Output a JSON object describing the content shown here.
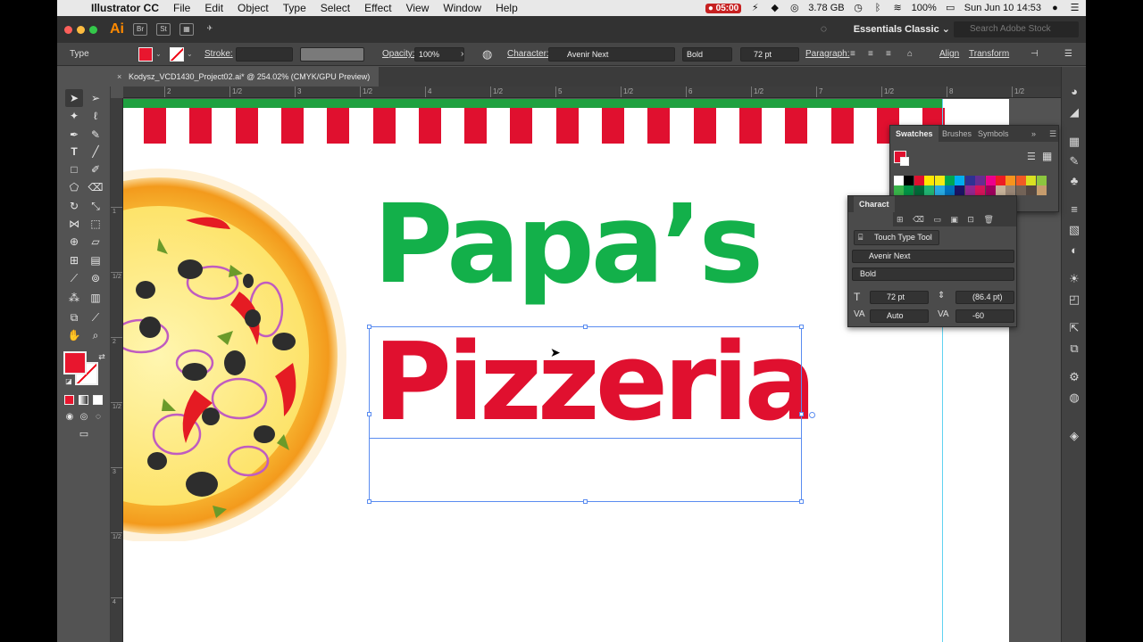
{
  "menubar": {
    "app_name": "Illustrator CC",
    "items": [
      "File",
      "Edit",
      "Object",
      "Type",
      "Select",
      "Effect",
      "View",
      "Window",
      "Help"
    ],
    "rec_time": "05:00",
    "memory": "3.78 GB",
    "battery": "100%",
    "datetime": "Sun Jun 10  14:53"
  },
  "appbar": {
    "logo": "Ai",
    "bridge": "Br",
    "stock": "St",
    "workspace": "Essentials Classic",
    "search_placeholder": "Search Adobe Stock"
  },
  "controlbar": {
    "mode": "Type",
    "stroke_label": "Stroke:",
    "opacity_label": "Opacity:",
    "opacity_value": "100%",
    "character_label": "Character:",
    "font_family": "Avenir Next",
    "font_style": "Bold",
    "font_size": "72 pt",
    "paragraph_label": "Paragraph:",
    "align_label": "Align",
    "transform_label": "Transform"
  },
  "document": {
    "tab_title": "Kodysz_VCD1430_Project02.ai* @ 254.02% (CMYK/GPU Preview)",
    "ruler_h": [
      "2",
      "1/2",
      "3",
      "1/2",
      "4",
      "1/2",
      "5",
      "1/2",
      "6",
      "1/2",
      "7",
      "1/2",
      "8",
      "1/2"
    ],
    "ruler_v": [
      "1",
      "1/2",
      "2",
      "1/2",
      "3",
      "1/2",
      "4",
      "1/2"
    ]
  },
  "artwork": {
    "line1": "Papa’s",
    "line2": "Pizzeria",
    "green": "#13b04a",
    "red": "#e0102f"
  },
  "swatches_panel": {
    "tabs": [
      "Swatches",
      "Brushes",
      "Symbols"
    ],
    "colors": [
      "#ffffff",
      "#000000",
      "#e0102f",
      "#ffe800",
      "#f5ea14",
      "#00a650",
      "#00aeef",
      "#2e3192",
      "#662d91",
      "#ec008c",
      "#ed1c24",
      "#f7941d",
      "#f15a24",
      "#d9e021",
      "#8cc63f",
      "#39b54a",
      "#009245",
      "#006837",
      "#22b573",
      "#29abe2",
      "#0071bc",
      "#1b1464",
      "#93278f",
      "#d4145a",
      "#9e005d",
      "#c7b299",
      "#998675",
      "#736357",
      "#534741",
      "#c69c6d",
      "#a67c52",
      "#8c6239",
      "#754c24",
      "#603813",
      "#42210b",
      "#f2f2f2"
    ]
  },
  "character_panel": {
    "title": "Charact",
    "touch_type": "Touch Type Tool",
    "font_family": "Avenir Next",
    "font_style": "Bold",
    "size": "72 pt",
    "leading": "(86.4 pt)",
    "kerning": "Auto",
    "tracking": "-60"
  }
}
